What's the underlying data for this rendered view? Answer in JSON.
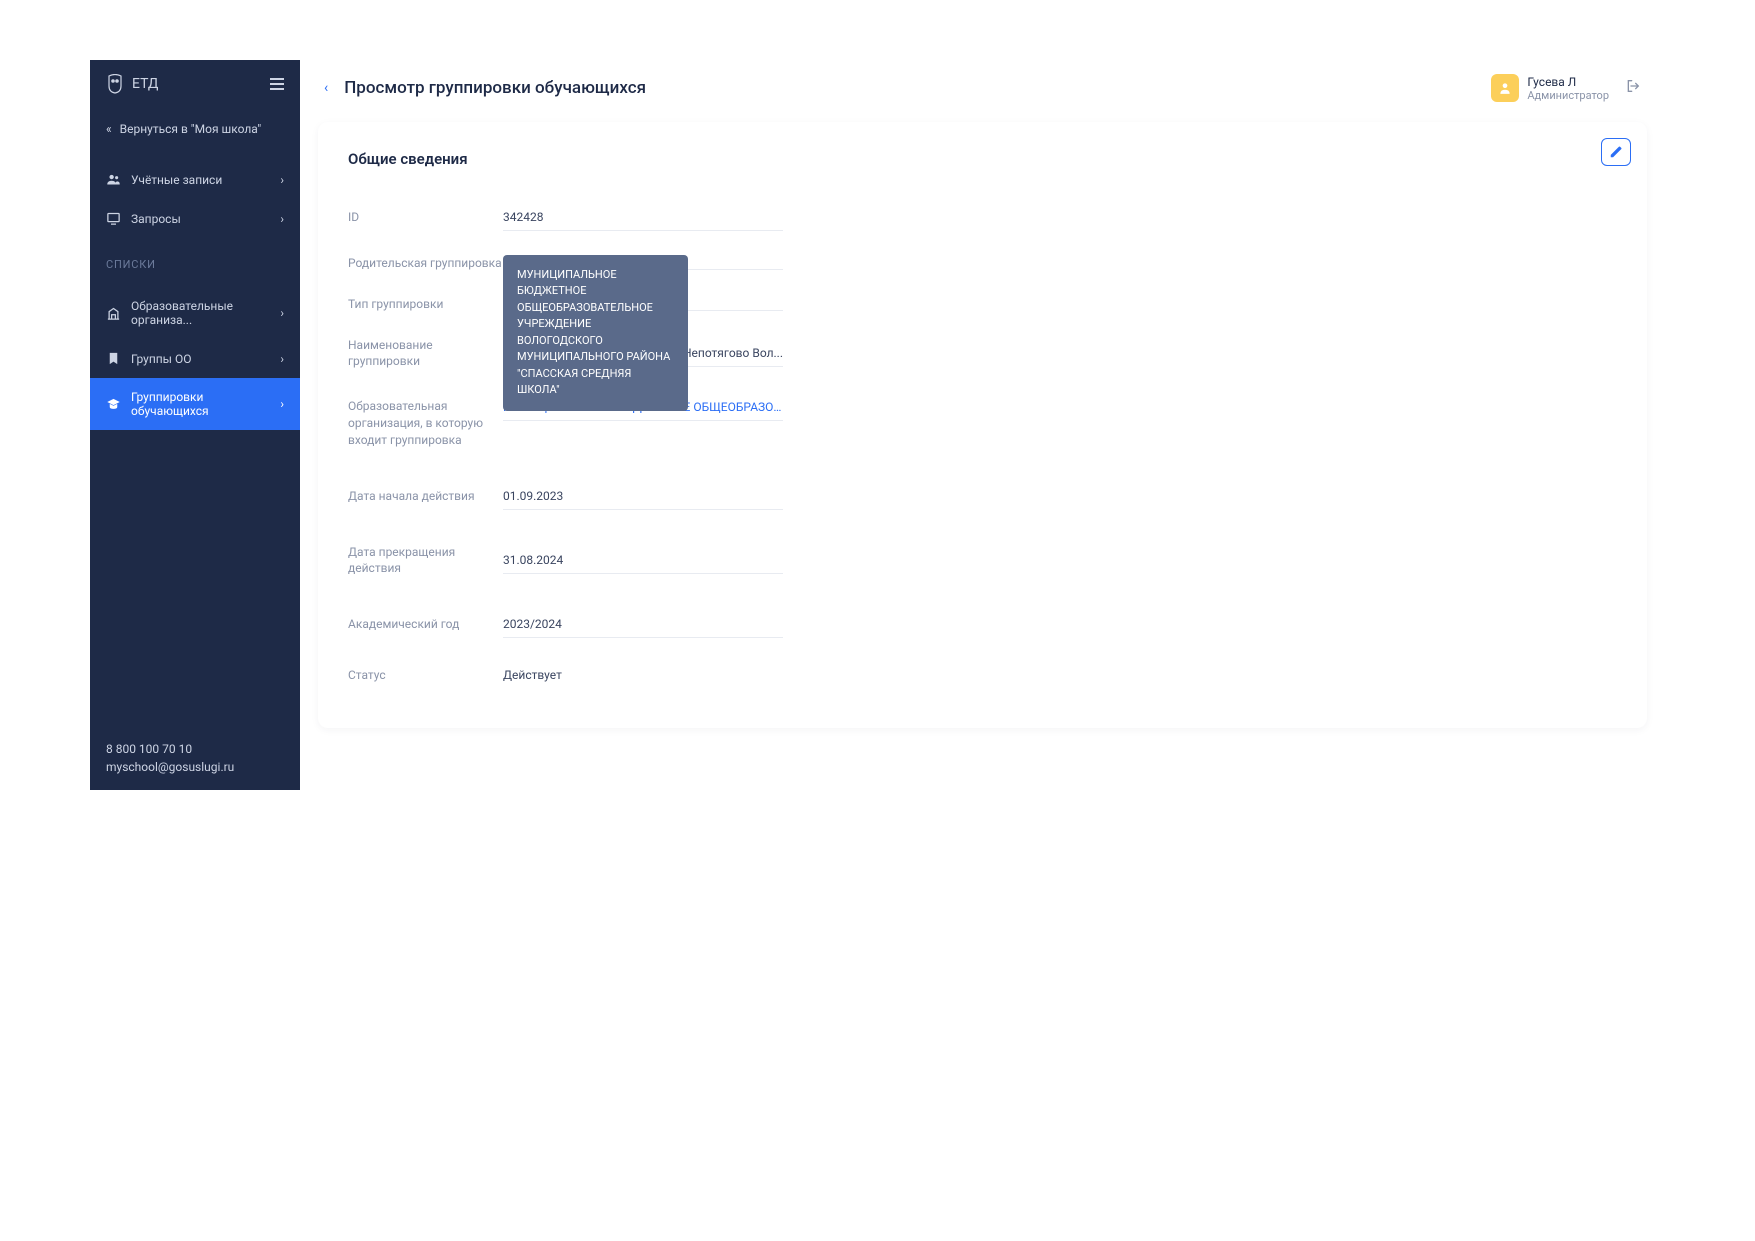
{
  "sidebar": {
    "logo_text": "ЕТД",
    "back_label": "Вернуться в \"Моя школа\"",
    "items": [
      {
        "label": "Учётные записи"
      },
      {
        "label": "Запросы"
      }
    ],
    "section_label": "СПИСКИ",
    "list_items": [
      {
        "label": "Образовательные организа..."
      },
      {
        "label": "Группы ОО"
      },
      {
        "label": "Группировки обучающихся"
      }
    ],
    "phone": "8 800 100 70 10",
    "email": "myschool@gosuslugi.ru"
  },
  "header": {
    "page_title": "Просмотр группировки обучающихся",
    "user_name": "Гусева Л",
    "user_role": "Администратор"
  },
  "card": {
    "title": "Общие сведения",
    "fields": {
      "id_label": "ID",
      "id_value": "342428",
      "parent_label": "Родительская группировка",
      "parent_value": "",
      "type_label": "Тип группировки",
      "type_value": "",
      "name_label": "Наименование группировки",
      "name_value": "п. Непотягово Вол...",
      "org_label": "Образовательная организация, в которую входит группировка",
      "org_value": "МУНИЦИПАЛЬНОЕ БЮДЖЕТНОЕ ОБЩЕОБРАЗОВАТЕ...",
      "start_label": "Дата начала действия",
      "start_value": "01.09.2023",
      "end_label": "Дата прекращения действия",
      "end_value": "31.08.2024",
      "year_label": "Академический год",
      "year_value": "2023/2024",
      "status_label": "Статус",
      "status_value": "Действует"
    },
    "tooltip": "МУНИЦИПАЛЬНОЕ БЮДЖЕТНОЕ ОБЩЕОБРАЗОВАТЕЛЬНОЕ УЧРЕЖДЕНИЕ ВОЛОГОДСКОГО МУНИЦИПАЛЬНОГО РАЙОНА \"СПАССКАЯ СРЕДНЯЯ ШКОЛА\""
  }
}
